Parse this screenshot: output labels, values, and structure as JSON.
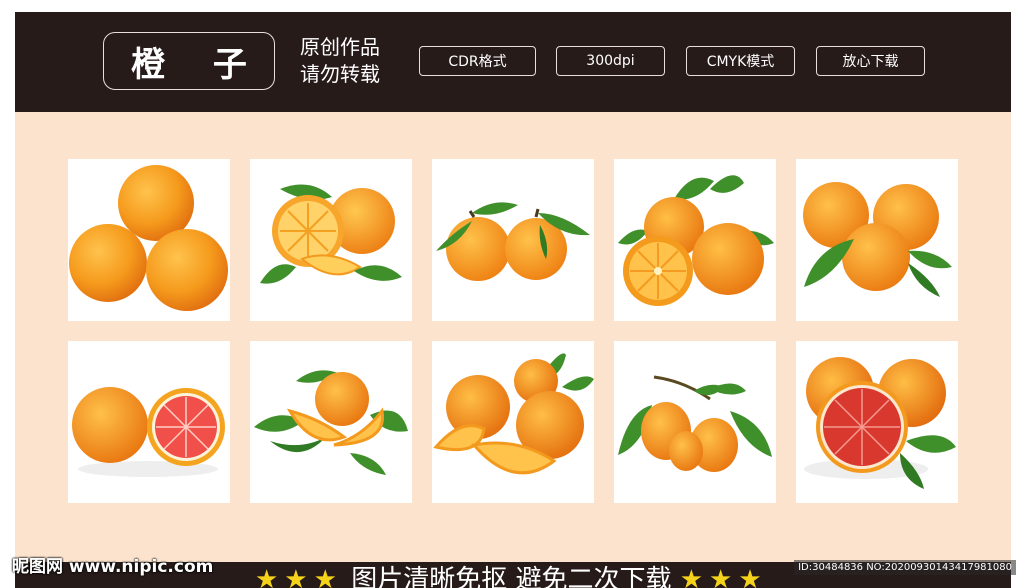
{
  "header": {
    "title": "橙 子",
    "note_line1": "原创作品",
    "note_line2": "请勿转载",
    "tags": [
      "CDR格式",
      "300dpi",
      "CMYK模式",
      "放心下载"
    ]
  },
  "footer": {
    "stars_left": "★★★",
    "notice": "图片清晰免抠 避免二次下载",
    "stars_right": "★★★"
  },
  "watermark": {
    "site": "昵图网 www.nipic.com",
    "id": "ID:30484836 NO:20200930143417981080"
  },
  "colors": {
    "header_bg": "#261b19",
    "panel_bg": "#fbe3cd",
    "orange": "#f39a1e",
    "leaf": "#3f8f2a",
    "blood_orange": "#e2463c"
  },
  "gallery": [
    {
      "name": "orange-pyramid-image"
    },
    {
      "name": "orange-sliced-illustration-image"
    },
    {
      "name": "two-oranges-with-leaves-image"
    },
    {
      "name": "orange-branch-with-half-image"
    },
    {
      "name": "three-oranges-image"
    },
    {
      "name": "orange-and-grapefruit-half-image"
    },
    {
      "name": "orange-with-wedges-image"
    },
    {
      "name": "oranges-with-slices-image"
    },
    {
      "name": "small-oranges-on-branch-image"
    },
    {
      "name": "blood-orange-half-image"
    }
  ]
}
